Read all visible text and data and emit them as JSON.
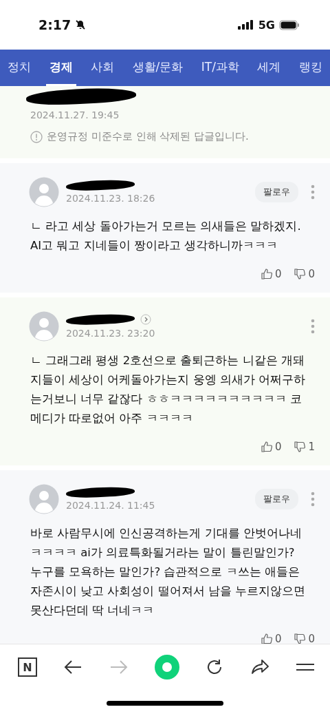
{
  "status_bar": {
    "time": "2:17",
    "network": "5G"
  },
  "tabs": [
    {
      "label": "정치",
      "selected": false
    },
    {
      "label": "경제",
      "selected": true
    },
    {
      "label": "사회",
      "selected": false
    },
    {
      "label": "생활/문화",
      "selected": false
    },
    {
      "label": "IT/과학",
      "selected": false
    },
    {
      "label": "세계",
      "selected": false
    },
    {
      "label": "랭킹",
      "selected": false
    }
  ],
  "deleted_comment": {
    "date": "2024.11.27. 19:45",
    "notice": "운영규정 미준수로 인해 삭제된 답글입니다."
  },
  "comments": [
    {
      "date": "2024.11.23. 18:26",
      "follow": "팔로우",
      "profile_arrow": false,
      "text": "ㄴ 라고 세상 돌아가는거 모르는 의새들은 말하겠지. AI고 뭐고 지네들이 짱이라고 생각하니까ㅋㅋㅋ",
      "likes": "0",
      "dislikes": "0"
    },
    {
      "date": "2024.11.23. 23:20",
      "profile_arrow": true,
      "text": "ㄴ 그래그래 평생 2호선으로 출퇴근하는 니같은 개돼지들이 세상이 어케돌아가는지 웅엥 의새가 어쩌구하는거보니 너무 같잖다 ㅎㅎㅋㅋㅋㅋㅋㅋㅋㅋㅋㅋ 코메디가 따로없어 아주 ㅋㅋㅋㅋ",
      "likes": "0",
      "dislikes": "1"
    },
    {
      "date": "2024.11.24. 11:45",
      "follow": "팔로우",
      "profile_arrow": false,
      "text": "바로 사람무시에 인신공격하는게 기대를 안벗어나네ㅋㅋㅋㅋ ai가 의료특화될거라는 말이 틀린말인가? 누구를 모욕하는 말인가? 습관적으로 ㅋ쓰는 애들은 자존시이 낮고 사회성이 떨어져서 남을 누르지않으면 못산다던데 딱 너네ㅋㅋ",
      "likes": "0",
      "dislikes": "0"
    }
  ],
  "toolbar": {
    "logo": "N",
    "forward_disabled": true
  }
}
